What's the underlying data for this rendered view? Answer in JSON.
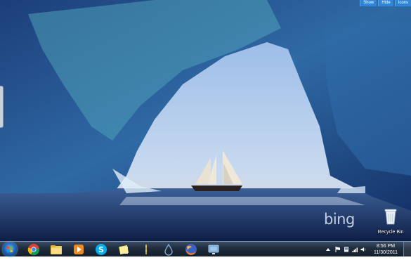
{
  "topbar": {
    "show": "Show",
    "hide": "Hide",
    "icons": "Icons"
  },
  "desktop": {
    "watermark": "bing",
    "recycle_bin_label": "Recycle Bin"
  },
  "taskbar": {
    "icons": [
      "start-orb",
      "chrome-icon",
      "explorer-folder-icon",
      "media-player-icon",
      "skype-icon",
      "sticky-notes-icon",
      "app-icon",
      "water-drop-icon",
      "firefox-icon",
      "network-icon"
    ],
    "clock": {
      "time": "8:56 PM",
      "date": "11/30/2011"
    }
  },
  "colors": {
    "taskbar": "#1f2c3d",
    "accent": "#2f86d8"
  }
}
